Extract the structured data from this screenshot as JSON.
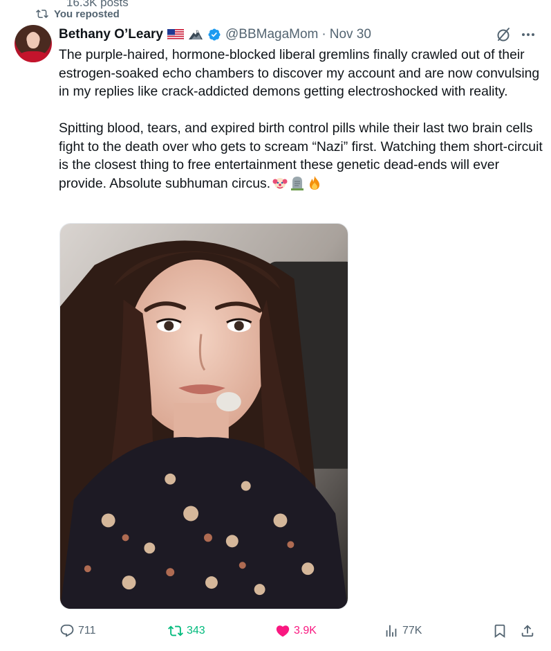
{
  "header_strip": {
    "posts_count": "16.3K posts"
  },
  "repost_banner": {
    "text": "You reposted"
  },
  "tweet": {
    "author_name": "Bethany O’Leary",
    "handle": "@BBMagaMom",
    "separator": "·",
    "date": "Nov 30",
    "paragraphs": [
      "The purple-haired, hormone-blocked liberal gremlins finally crawled out of their estrogen-soaked echo chambers to discover my account and are now convulsing in my replies like crack-addicted demons getting electroshocked with reality.",
      "Spitting blood, tears, and expired birth control pills while their last two brain cells fight to the death over who gets to scream “Nazi” first. Watching them short-circuit is the closest thing to free entertainment these genetic dead-ends will ever provide. Absolute subhuman circus."
    ],
    "trailing_emojis": [
      "clown-emoji",
      "headstone-emoji",
      "fire-emoji"
    ],
    "name_badges": [
      "us-flag-icon",
      "eagle-icon",
      "verified-badge-icon"
    ]
  },
  "actions": {
    "replies": "711",
    "reposts": "343",
    "likes": "3.9K",
    "views": "77K"
  },
  "colors": {
    "text_primary": "#0f1419",
    "text_secondary": "#536471",
    "verified_blue": "#1d9bf0",
    "repost_green": "#00ba7c",
    "like_pink": "#f91880"
  }
}
